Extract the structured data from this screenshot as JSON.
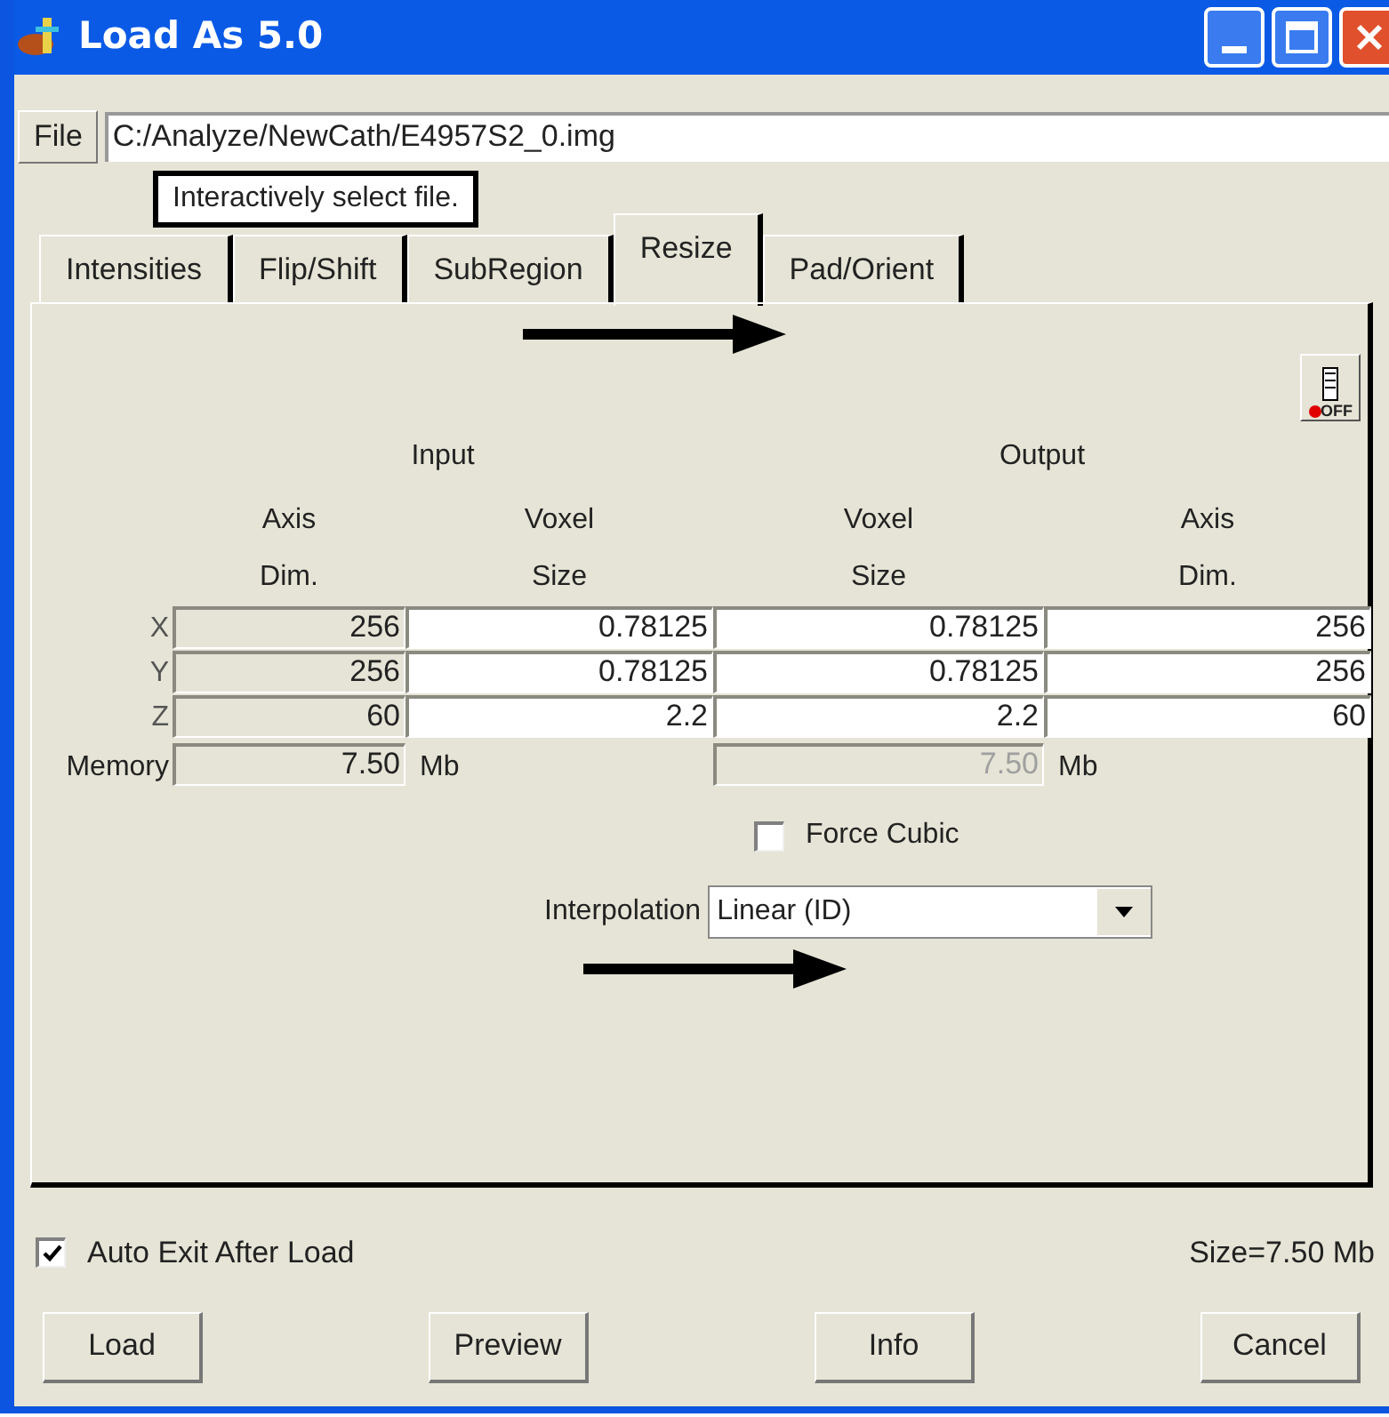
{
  "window": {
    "title": "Load As 5.0"
  },
  "file": {
    "button": "File",
    "path": "C:/Analyze/NewCath/E4957S2_0.img"
  },
  "tooltip": "Interactively select file.",
  "tabs": [
    {
      "label": "Intensities",
      "selected": false
    },
    {
      "label": "Flip/Shift",
      "selected": false
    },
    {
      "label": "SubRegion",
      "selected": false
    },
    {
      "label": "Resize",
      "selected": true
    },
    {
      "label": "Pad/Orient",
      "selected": false
    }
  ],
  "toggle_button": {
    "label": "OFF",
    "on": false
  },
  "group_headers": [
    "Input",
    "Output"
  ],
  "columns": [
    {
      "line1": "Axis",
      "line2": "Dim."
    },
    {
      "line1": "Voxel",
      "line2": "Size"
    },
    {
      "line1": "Voxel",
      "line2": "Size"
    },
    {
      "line1": "Axis",
      "line2": "Dim."
    }
  ],
  "rows": [
    {
      "label": "X",
      "cells": [
        {
          "value": "256",
          "editable": false
        },
        {
          "value": "0.78125",
          "editable": true
        },
        {
          "value": "0.78125",
          "editable": true
        },
        {
          "value": "256",
          "editable": true
        }
      ]
    },
    {
      "label": "Y",
      "cells": [
        {
          "value": "256",
          "editable": false
        },
        {
          "value": "0.78125",
          "editable": true
        },
        {
          "value": "0.78125",
          "editable": true
        },
        {
          "value": "256",
          "editable": true
        }
      ]
    },
    {
      "label": "Z",
      "cells": [
        {
          "value": "60",
          "editable": false
        },
        {
          "value": "2.2",
          "editable": true
        },
        {
          "value": "2.2",
          "editable": true
        },
        {
          "value": "60",
          "editable": true
        }
      ]
    }
  ],
  "memory": {
    "label": "Memory",
    "input": {
      "value": "7.50",
      "disabled": false
    },
    "input_unit": "Mb",
    "output": {
      "value": "7.50",
      "disabled": true
    },
    "output_unit": "Mb"
  },
  "force_cubic": {
    "label": "Force Cubic",
    "checked": false
  },
  "interpolation": {
    "label": "Interpolation",
    "value": "Linear (ID)"
  },
  "auto_exit": {
    "label": "Auto Exit After Load",
    "checked": true
  },
  "size": "Size=7.50 Mb",
  "buttons": [
    "Load",
    "Preview",
    "Info",
    "Cancel"
  ]
}
